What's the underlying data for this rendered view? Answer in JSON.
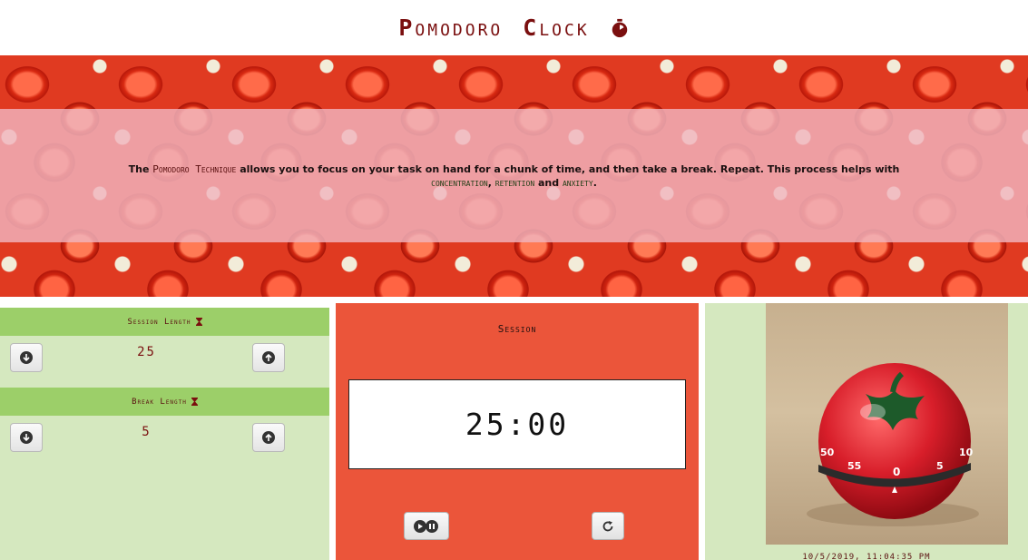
{
  "header": {
    "title_first": "P",
    "title_rest1": "omodoro",
    "title_second": "C",
    "title_rest2": "lock"
  },
  "intro": {
    "the": "The",
    "technique": "Pomodoro Technique",
    "middle": "allows you to focus on your task on hand for a chunk of time, and then take a break. Repeat. This process helps with",
    "concentration": "concentration",
    "comma": ",",
    "retention": "retention",
    "and": "and",
    "anxiety": "anxiety",
    "period": "."
  },
  "settings": {
    "session_label": "Session Length",
    "session_value": "25",
    "break_label": "Break Length",
    "break_value": "5"
  },
  "timer": {
    "label": "Session",
    "time": "25:00"
  },
  "photo": {
    "dial_numbers": [
      "50",
      "55",
      "0",
      "5",
      "10"
    ]
  },
  "footer": {
    "datetime": "10/5/2019, 11:04:35 PM"
  },
  "colors": {
    "title": "#7a0f0f",
    "settings_bg": "#d5e8bf",
    "settings_head": "#9ccf69",
    "timer_bg": "#eb553a"
  },
  "icons": {
    "title_icon": "stopwatch-icon",
    "hourglass": "hourglass-icon",
    "decrement": "arrow-down-circle-icon",
    "increment": "arrow-up-circle-icon",
    "play_pause": "play-pause-icon",
    "reset": "reset-icon"
  }
}
